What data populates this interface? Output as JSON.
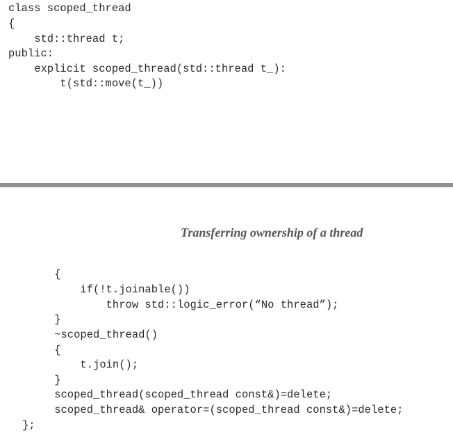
{
  "top_code": {
    "lines": [
      "class scoped_thread",
      "{",
      "    std::thread t;",
      "public:",
      "    explicit scoped_thread(std::thread t_):",
      "        t(std::move(t_))"
    ]
  },
  "running_head": "Transferring ownership of a thread",
  "bottom_code": {
    "lines": [
      "    {",
      "        if(!t.joinable())",
      "            throw std::logic_error(“No thread”);",
      "    }",
      "    ~scoped_thread()",
      "    {",
      "        t.join();",
      "    }",
      "    scoped_thread(scoped_thread const&)=delete;",
      "    scoped_thread& operator=(scoped_thread const&)=delete;",
      "};"
    ]
  }
}
